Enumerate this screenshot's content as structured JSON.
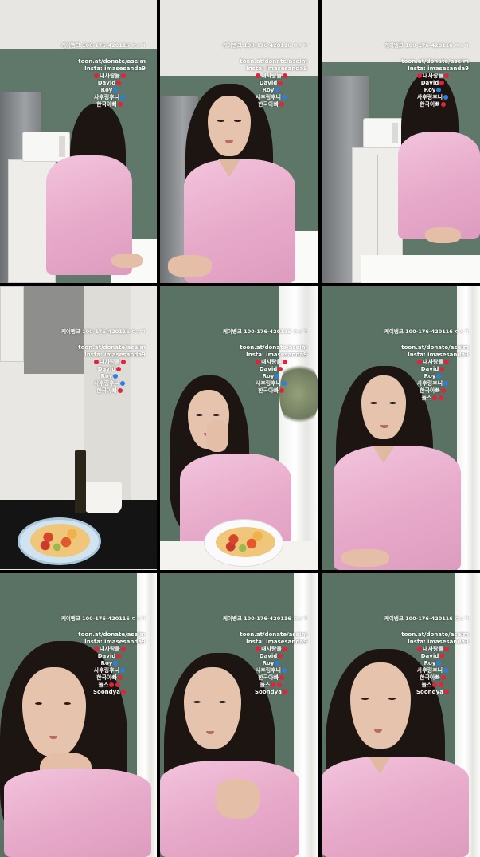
{
  "frames": [
    {
      "overlay": {
        "bank": "케이뱅크 100-176-420116 ㅇㅅㄱ",
        "lines": [
          "toon.at/donate/aseim",
          "Insta: imasesanda9",
          "내사랑들",
          "David",
          "Roy",
          "사후링후니",
          "한국아빠"
        ]
      }
    },
    {
      "overlay": {
        "bank": "케이뱅크 100-176-420116 ㅇㅅㄱ",
        "lines": [
          "toon.at/donate/aseim",
          "Insta: imasesanda9",
          "내사랑들",
          "David",
          "Roy",
          "사후링후니",
          "한국아빠"
        ]
      }
    },
    {
      "overlay": {
        "bank": "케이뱅크 100-176-420116 ㅇㅅㄱ",
        "lines": [
          "toon.at/donate/aseim",
          "Insta: imasesanda9",
          "내사랑들",
          "David",
          "Roy",
          "사후링후니",
          "한국아빠"
        ]
      }
    },
    {
      "overlay": {
        "bank": "케이뱅크 100-176-420116 ㅇㅅㄱ",
        "lines": [
          "toon.at/donate/aseim",
          "Insta: imasesanda9",
          "내사랑들",
          "David",
          "Roy",
          "사후링후니",
          "한국아빠"
        ]
      }
    },
    {
      "overlay": {
        "bank": "케이뱅크 100-176-420116 ㅇㅅㄱ",
        "lines": [
          "toon.at/donate/aseim",
          "Insta: imasesanda9",
          "내사랑들",
          "David",
          "Roy",
          "사후링후니",
          "한국아빠"
        ]
      }
    },
    {
      "overlay": {
        "bank": "케이뱅크 100-176-420116 ㅇㅅㄱ",
        "lines": [
          "toon.at/donate/aseim",
          "Insta: imasesanda9",
          "내사랑들",
          "David",
          "Roy",
          "사후링후니",
          "한국아빠",
          "둘스"
        ]
      }
    },
    {
      "overlay": {
        "bank": "케이뱅크 100-176-420116 ㅇㅅㄱ",
        "lines": [
          "toon.at/donate/aseim",
          "Insta: imasesanda9",
          "내사랑들",
          "David",
          "Roy",
          "사후링후니",
          "한국아빠",
          "둘스",
          "Soondya"
        ]
      }
    },
    {
      "overlay": {
        "bank": "케이뱅크 100-176-420116 ㅇㅅㄱ",
        "lines": [
          "toon.at/donate/aseim",
          "Insta: imasesanda9",
          "내사랑들",
          "David",
          "Roy",
          "사후링후니",
          "한국아빠",
          "둘스",
          "Soondya"
        ]
      }
    },
    {
      "overlay": {
        "bank": "케이뱅크 100-176-420116 ㅇㅅㄱ",
        "lines": [
          "toon.at/donate/aseim",
          "Insta: imasesanda9",
          "내사랑들",
          "David",
          "Roy",
          "사후링후니",
          "한국아빠",
          "둘스",
          "Soondya"
        ]
      }
    }
  ],
  "colors": {
    "wall_green": "#5e7566",
    "wall_green_dark": "#4e6356",
    "shirt_pink": "#e7a9c9",
    "heart_red": "#e0243a",
    "heart_blue": "#2f7de0"
  }
}
